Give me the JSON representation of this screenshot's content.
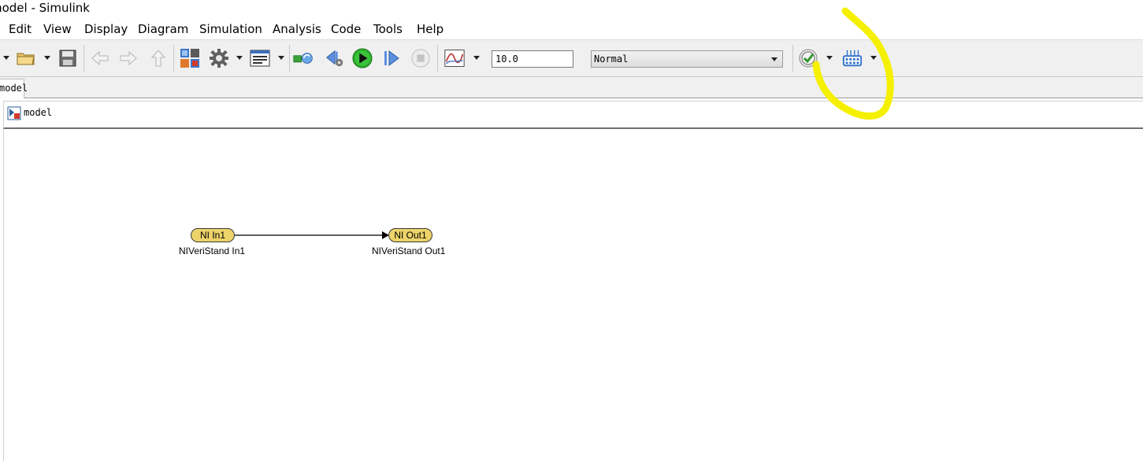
{
  "window": {
    "title": "model - Simulink"
  },
  "menu": {
    "items": [
      "Edit",
      "View",
      "Display",
      "Diagram",
      "Simulation",
      "Analysis",
      "Code",
      "Tools",
      "Help"
    ]
  },
  "toolbar": {
    "stop_time": "10.0",
    "simulation_mode": "Normal",
    "icons": {
      "new": "new-model-icon",
      "open": "open-folder-icon",
      "save": "save-icon",
      "back": "back-arrow-icon",
      "forward": "forward-arrow-icon",
      "up": "up-arrow-icon",
      "library": "library-browser-icon",
      "config": "gear-icon",
      "explorer": "model-explorer-icon",
      "update": "update-diagram-icon",
      "step_back": "step-back-icon",
      "run": "run-icon",
      "step_forward": "step-forward-icon",
      "stop": "stop-icon",
      "data_inspector": "data-inspector-icon",
      "advisor": "model-advisor-icon",
      "build": "build-icon"
    },
    "colors": {
      "run": "#2bb02b",
      "highlight": "#f5f000"
    }
  },
  "tabs": [
    {
      "label": "model"
    }
  ],
  "address": {
    "path": "model"
  },
  "diagram": {
    "blocks": [
      {
        "label": "NI In1",
        "caption": "NIVeriStand In1"
      },
      {
        "label": "NI Out1",
        "caption": "NIVeriStand Out1"
      }
    ],
    "block_color": "#ecd36a"
  }
}
